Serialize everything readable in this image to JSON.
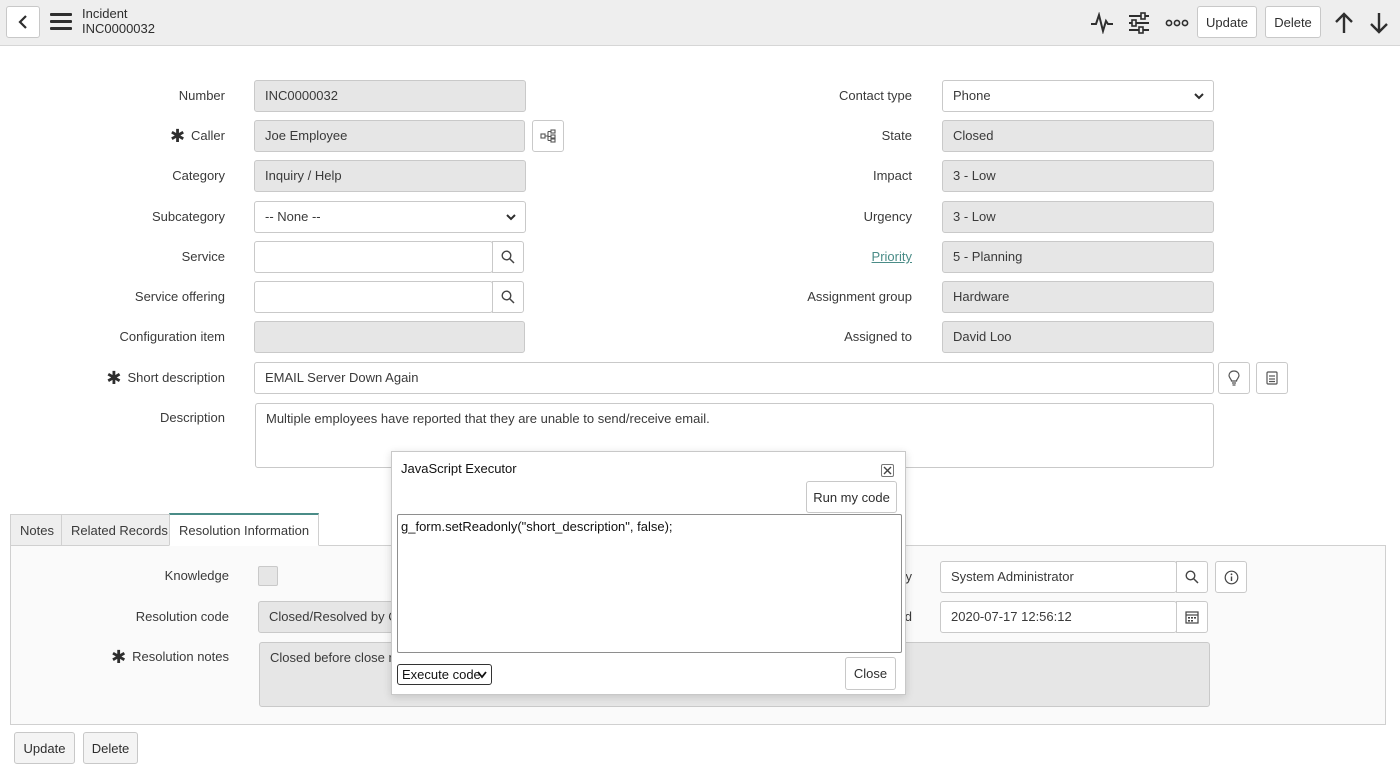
{
  "header": {
    "title": "Incident",
    "number": "INC0000032",
    "update_label": "Update",
    "delete_label": "Delete"
  },
  "form": {
    "left": [
      {
        "label": "Number",
        "value": "INC0000032"
      },
      {
        "label": "Caller",
        "value": "Joe Employee"
      },
      {
        "label": "Category",
        "value": "Inquiry / Help"
      },
      {
        "label": "Subcategory",
        "value": "-- None --"
      },
      {
        "label": "Service",
        "value": ""
      },
      {
        "label": "Service offering",
        "value": ""
      },
      {
        "label": "Configuration item",
        "value": ""
      }
    ],
    "right": [
      {
        "label": "Contact type",
        "value": "Phone"
      },
      {
        "label": "State",
        "value": "Closed"
      },
      {
        "label": "Impact",
        "value": "3 - Low"
      },
      {
        "label": "Urgency",
        "value": "3 - Low"
      },
      {
        "label": "Priority",
        "value": "5 - Planning"
      },
      {
        "label": "Assignment group",
        "value": "Hardware"
      },
      {
        "label": "Assigned to",
        "value": "David Loo"
      }
    ],
    "short_description": {
      "label": "Short description",
      "value": "EMAIL Server Down Again"
    },
    "description": {
      "label": "Description",
      "value": "Multiple employees have reported that they are unable to send/receive email."
    }
  },
  "tabs": [
    {
      "label": "Notes",
      "active": false
    },
    {
      "label": "Related Records",
      "active": false
    },
    {
      "label": "Resolution Information",
      "active": true
    }
  ],
  "resolution": {
    "knowledge_label": "Knowledge",
    "code_label": "Resolution code",
    "code_value": "Closed/Resolved by Ca",
    "notes_label": "Resolution notes",
    "notes_value": "Closed before close no",
    "resolved_by_label_tail": "y",
    "resolved_by_value": "System Administrator",
    "resolved_label_tail": "d",
    "resolved_value": "2020-07-17 12:56:12"
  },
  "modal": {
    "title": "JavaScript Executor",
    "run_label": "Run my code",
    "code": "g_form.setReadonly(\"short_description\", false);",
    "mode": "Execute code",
    "close_label": "Close"
  },
  "footer": {
    "update_label": "Update",
    "delete_label": "Delete"
  },
  "colors": {
    "accent": "#4a8c87",
    "header_bg": "#eeeeee",
    "readonly_field": "#e6e6e6"
  }
}
